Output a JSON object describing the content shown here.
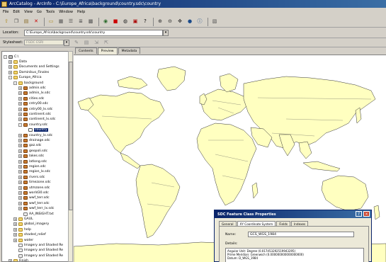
{
  "window": {
    "title": "ArcCatalog - ArcInfo - C:\\Europe_Africa\\background\\country.sdc\\country"
  },
  "menu": [
    "File",
    "Edit",
    "View",
    "Go",
    "Tools",
    "Window",
    "Help"
  ],
  "toolbar": {
    "icons": [
      "up-folder-icon",
      "copy-icon",
      "paste-icon",
      "delete-icon",
      "connect-folder-icon",
      "large-icons-icon",
      "list-icon",
      "details-icon",
      "thumbnails-icon",
      "launch-arcmap-icon",
      "metadata-icon",
      "search-icon",
      "arc-toolbox-icon",
      "help-icon",
      "zoom-in-icon",
      "zoom-out-icon",
      "pan-icon",
      "full-extent-icon",
      "identify-icon",
      "create-thumbnail-icon"
    ]
  },
  "location": {
    "label": "Location:",
    "value": "C:\\Europe_Africa\\background\\country.sdc\\country"
  },
  "stylesheet": {
    "label": "Stylesheet:",
    "value": "FGDC ESRI"
  },
  "tree": [
    {
      "label": "C:\\",
      "icon": "drive",
      "level": 0,
      "expander": "-"
    },
    {
      "label": "Data",
      "icon": "folder",
      "level": 1,
      "expander": "+"
    },
    {
      "label": "Documents and Settings",
      "icon": "folder",
      "level": 1,
      "expander": "+"
    },
    {
      "label": "Dominikus_Finales",
      "icon": "folder",
      "level": 1,
      "expander": "+"
    },
    {
      "label": "Europe_Africa",
      "icon": "folder",
      "level": 1,
      "expander": "-"
    },
    {
      "label": "background",
      "icon": "folder",
      "level": 2,
      "expander": "-"
    },
    {
      "label": "admin.sdc",
      "icon": "fc",
      "level": 3,
      "expander": "+"
    },
    {
      "label": "admin_lx.sdc",
      "icon": "fc",
      "level": 3,
      "expander": "+"
    },
    {
      "label": "cities.sdc",
      "icon": "fc",
      "level": 3,
      "expander": "+"
    },
    {
      "label": "cntry00.sdc",
      "icon": "fc",
      "level": 3,
      "expander": "+"
    },
    {
      "label": "cntry00_lx.sdc",
      "icon": "fc",
      "level": 3,
      "expander": "+"
    },
    {
      "label": "continent.sdc",
      "icon": "fc",
      "level": 3,
      "expander": "+"
    },
    {
      "label": "continent_lx.sdc",
      "icon": "fc",
      "level": 3,
      "expander": "+"
    },
    {
      "label": "country.sdc",
      "icon": "fc",
      "level": 3,
      "expander": "-"
    },
    {
      "label": "country",
      "icon": "table",
      "level": 4,
      "expander": ""
    },
    {
      "label": "country_lx.sdc",
      "icon": "fc",
      "level": 3,
      "expander": "+"
    },
    {
      "label": "drainage.sdc",
      "icon": "fc",
      "level": 3,
      "expander": "+"
    },
    {
      "label": "gaz.sdc",
      "icon": "fc",
      "level": 3,
      "expander": "+"
    },
    {
      "label": "geopoli.sdc",
      "icon": "fc",
      "level": 3,
      "expander": "+"
    },
    {
      "label": "lakes.sdc",
      "icon": "fc",
      "level": 3,
      "expander": "+"
    },
    {
      "label": "latlong.sdc",
      "icon": "fc",
      "level": 3,
      "expander": "+"
    },
    {
      "label": "region.sdc",
      "icon": "fc",
      "level": 3,
      "expander": "+"
    },
    {
      "label": "region_lx.sdc",
      "icon": "fc",
      "level": 3,
      "expander": "+"
    },
    {
      "label": "rivers.sdc",
      "icon": "fc",
      "level": 3,
      "expander": "+"
    },
    {
      "label": "timezone.sdc",
      "icon": "fc",
      "level": 3,
      "expander": "+"
    },
    {
      "label": "utmzone.sdc",
      "icon": "fc",
      "level": 3,
      "expander": "+"
    },
    {
      "label": "world30.sdc",
      "icon": "fc",
      "level": 3,
      "expander": "+"
    },
    {
      "label": "wwf_terr.sdc",
      "icon": "fc",
      "level": 3,
      "expander": "+"
    },
    {
      "label": "wwf_terr.sdc",
      "icon": "fc",
      "level": 3,
      "expander": "+"
    },
    {
      "label": "wwf_terr_lx.sdc",
      "icon": "fc",
      "level": 3,
      "expander": "+"
    },
    {
      "label": "AA_INSIGHT.txt",
      "icon": "file",
      "level": 3,
      "expander": ""
    },
    {
      "label": "GAUL",
      "icon": "folder",
      "level": 2,
      "expander": "+"
    },
    {
      "label": "global_imagery",
      "icon": "folder",
      "level": 2,
      "expander": "+"
    },
    {
      "label": "help",
      "icon": "folder",
      "level": 2,
      "expander": "+"
    },
    {
      "label": "shaded_relief",
      "icon": "folder",
      "level": 2,
      "expander": "+"
    },
    {
      "label": "water",
      "icon": "folder",
      "level": 2,
      "expander": "+"
    },
    {
      "label": "Imagery and Shaded Re",
      "icon": "file",
      "level": 2,
      "expander": ""
    },
    {
      "label": "Imagery and Shaded Re",
      "icon": "file",
      "level": 2,
      "expander": ""
    },
    {
      "label": "Imagery and Shaded Re",
      "icon": "file",
      "level": 2,
      "expander": ""
    },
    {
      "label": "Finish",
      "icon": "folder",
      "level": 1,
      "expander": "+"
    }
  ],
  "tabs": [
    {
      "label": "Contents",
      "active": false
    },
    {
      "label": "Preview",
      "active": true
    },
    {
      "label": "Metadata",
      "active": false
    }
  ],
  "preview": {
    "fill_color": "#ffffc0",
    "outline_color": "#333333"
  },
  "dialog": {
    "title": "SDC Feature Class Properties",
    "tabs": [
      {
        "label": "General",
        "active": false
      },
      {
        "label": "XY Coordinate System",
        "active": true
      },
      {
        "label": "Fields",
        "active": false
      },
      {
        "label": "Indexes",
        "active": false
      }
    ],
    "name_label": "Name:",
    "name_value": "GCS_WGS_1984",
    "details_label": "Details:",
    "details_lines": [
      "Angular Unit: Degree (0.017453292519943295)",
      "Prime Meridian: Greenwich (0.000000000000000000)",
      "Datum: D_WGS_1984"
    ]
  }
}
